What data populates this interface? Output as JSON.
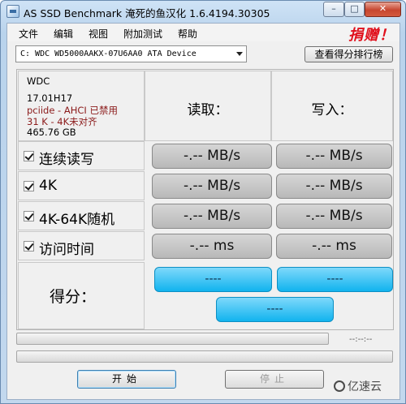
{
  "window": {
    "title": "AS SSD Benchmark 淹死的鱼汉化 1.6.4194.30305",
    "minimize_glyph": "–",
    "maximize_glyph": "□",
    "close_glyph": "✕"
  },
  "menu": {
    "items": [
      "文件",
      "编辑",
      "视图",
      "附加测试",
      "帮助"
    ],
    "promo": "捐赠！"
  },
  "drive": {
    "selected": "C: WDC WD5000AAKX-07U6AA0 ATA Device",
    "ranking_button": "查看得分排行榜"
  },
  "drive_info": {
    "brand": "WDC",
    "firmware": "17.01H17",
    "ahci": "pciide - AHCI 已禁用",
    "alignment": "31 K - 4K未对齐",
    "size": "465.76 GB"
  },
  "columns": {
    "read": "读取：",
    "write": "写入："
  },
  "tests": [
    {
      "label": "连续读写",
      "checked": true,
      "read": "-.-- MB/s",
      "write": "-.-- MB/s"
    },
    {
      "label": "4K",
      "checked": true,
      "read": "-.-- MB/s",
      "write": "-.-- MB/s"
    },
    {
      "label": "4K-64K随机",
      "checked": true,
      "read": "-.-- MB/s",
      "write": "-.-- MB/s"
    },
    {
      "label": "访问时间",
      "checked": true,
      "read": "-.-- ms",
      "write": "-.-- ms"
    }
  ],
  "score": {
    "label": "得分：",
    "read": "----",
    "write": "----",
    "total": "----"
  },
  "progress": {
    "elapsed": "--:--:--",
    "bar1_fraction": 0,
    "bar2_fraction": 0
  },
  "buttons": {
    "start": "开始",
    "stop": "停止"
  },
  "watermark": "亿速云",
  "colors": {
    "score_box": "#11b3ee",
    "result_box": "#b8b8b8",
    "promo": "#e0101c",
    "warning_text": "#8b1a1a"
  }
}
